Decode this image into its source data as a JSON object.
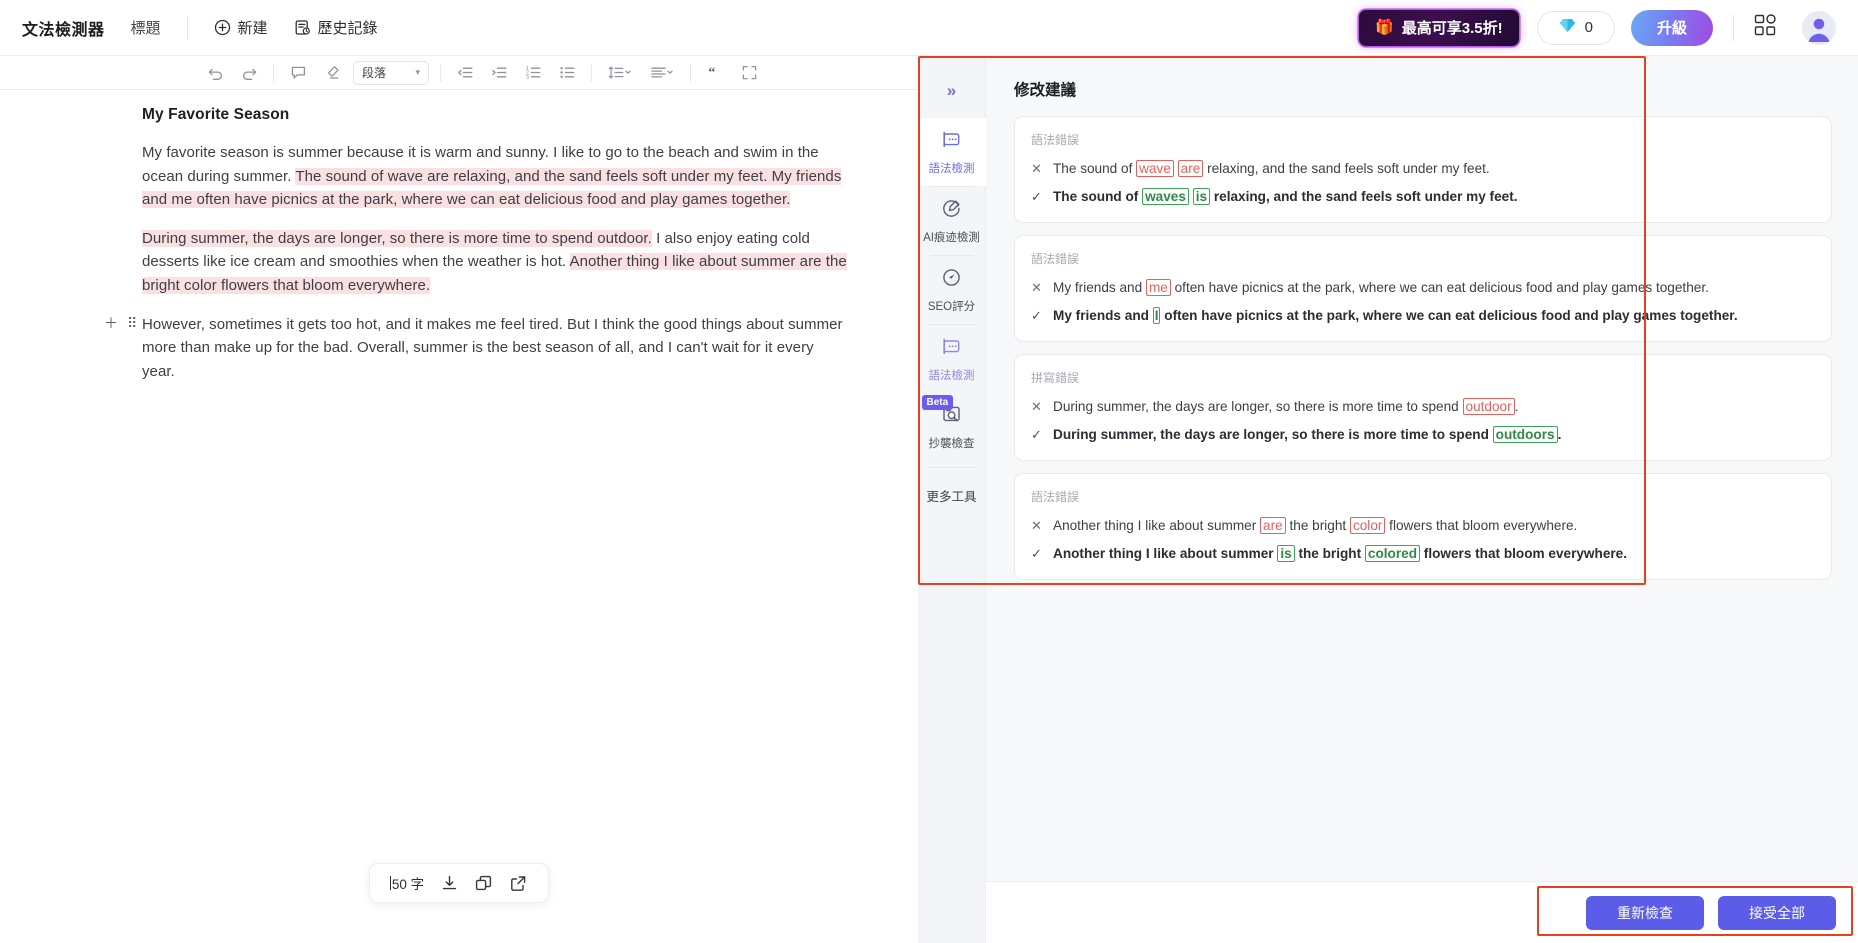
{
  "header": {
    "brand": "文法檢測器",
    "doc_title": "標題",
    "new_label": "新建",
    "history_label": "歷史記錄",
    "promo_label": "最高可享3.5折!",
    "promo_icon": "gift-icon",
    "credits_value": "0",
    "credits_icon": "diamond-icon",
    "upgrade_label": "升級",
    "grid_icon": "apps-grid-icon",
    "avatar_icon": "user-avatar-icon"
  },
  "toolbar": {
    "undo": "undo-icon",
    "redo": "redo-icon",
    "comment": "comment-icon",
    "clear_format": "eraser-icon",
    "style_select": "段落",
    "indent_decrease": "indent-decrease-icon",
    "indent_increase": "indent-increase-icon",
    "ordered_list": "ordered-list-icon",
    "bullet_list": "bullet-list-icon",
    "line_height": "line-height-icon",
    "align": "align-icon",
    "quote": "quote-icon",
    "fullscreen": "fullscreen-icon"
  },
  "document": {
    "heading": "My Favorite Season",
    "paragraph1": {
      "segments": [
        {
          "text": "My favorite season is summer because it is warm and sunny. I like to go to the beach and swim in the ocean during summer. ",
          "highlight": false
        },
        {
          "text": "The sound of wave are relaxing, and the sand feels soft under my feet. My friends and me often have picnics at the park, where we can eat delicious food and play games together.",
          "highlight": true
        }
      ]
    },
    "paragraph2": {
      "segments": [
        {
          "text": "During summer, the days are longer, so there is more time to spend outdoor.",
          "highlight": true
        },
        {
          "text": " I also enjoy eating cold desserts like ice cream and smoothies when the weather is hot. ",
          "highlight": false
        },
        {
          "text": "Another thing I like about summer are the bright color flowers that bloom everywhere.",
          "highlight": true
        }
      ]
    },
    "paragraph3": {
      "segments": [
        {
          "text": "However, sometimes it gets too hot, and it makes me feel tired. But I think the good things about summer more than make up for the bad. Overall, summer is the best season of all, and I can't wait for it every year.",
          "highlight": false
        }
      ]
    },
    "handles": {
      "add": "plus-icon",
      "drag": "drag-dots-icon"
    }
  },
  "float_bar": {
    "word_count": "50 字",
    "download_icon": "download-icon",
    "copy_icon": "copy-icon",
    "export_icon": "external-link-icon"
  },
  "rail": {
    "collapse_icon": "chevron-double-right-icon",
    "items": [
      {
        "label": "語法檢測",
        "icon": "grammar-check-icon",
        "active": true,
        "badge": ""
      },
      {
        "label": "AI痕迹檢測",
        "icon": "ai-detect-icon",
        "active": false,
        "badge": ""
      },
      {
        "label": "SEO評分",
        "icon": "seo-score-icon",
        "active": false,
        "badge": ""
      },
      {
        "label": "語法檢測",
        "icon": "grammar-check-icon",
        "active": false,
        "badge": ""
      },
      {
        "label": "抄襲檢查",
        "icon": "plagiarism-icon",
        "active": false,
        "badge": "Beta"
      }
    ],
    "more_label": "更多工具"
  },
  "suggestions": {
    "title": "修改建議",
    "cards": [
      {
        "type": "語法錯誤",
        "error_mark": "✕",
        "fix_mark": "✓",
        "error": [
          {
            "t": "The sound of ",
            "k": "plain"
          },
          {
            "t": "wave",
            "k": "bad"
          },
          {
            "t": " ",
            "k": "plain"
          },
          {
            "t": "are",
            "k": "bad"
          },
          {
            "t": " relaxing, and the sand feels soft under my feet.",
            "k": "plain"
          }
        ],
        "fix": [
          {
            "t": "The sound of ",
            "k": "plain"
          },
          {
            "t": "waves",
            "k": "good"
          },
          {
            "t": " ",
            "k": "plain"
          },
          {
            "t": "is",
            "k": "good"
          },
          {
            "t": " relaxing, and the sand feels soft under my feet.",
            "k": "plain"
          }
        ]
      },
      {
        "type": "語法錯誤",
        "error_mark": "✕",
        "fix_mark": "✓",
        "error": [
          {
            "t": "My friends and ",
            "k": "plain"
          },
          {
            "t": "me",
            "k": "bad"
          },
          {
            "t": " often have picnics at the park, where we can eat delicious food and play games together.",
            "k": "plain"
          }
        ],
        "fix": [
          {
            "t": "My friends and ",
            "k": "plain"
          },
          {
            "t": "I",
            "k": "good"
          },
          {
            "t": " often have picnics at the park, where we can eat delicious food and play games together.",
            "k": "plain"
          }
        ]
      },
      {
        "type": "拼寫錯誤",
        "error_mark": "✕",
        "fix_mark": "✓",
        "error": [
          {
            "t": "During summer, the days are longer, so there is more time to spend ",
            "k": "plain"
          },
          {
            "t": "outdoor",
            "k": "bad"
          },
          {
            "t": ".",
            "k": "plain"
          }
        ],
        "fix": [
          {
            "t": "During summer, the days are longer, so there is more time to spend ",
            "k": "plain"
          },
          {
            "t": "outdoors",
            "k": "good"
          },
          {
            "t": ".",
            "k": "plain"
          }
        ]
      },
      {
        "type": "語法錯誤",
        "error_mark": "✕",
        "fix_mark": "✓",
        "error": [
          {
            "t": "Another thing I like about summer ",
            "k": "plain"
          },
          {
            "t": "are",
            "k": "bad"
          },
          {
            "t": " the bright ",
            "k": "plain"
          },
          {
            "t": "color",
            "k": "bad"
          },
          {
            "t": " flowers that bloom everywhere.",
            "k": "plain"
          }
        ],
        "fix": [
          {
            "t": "Another thing I like about summer ",
            "k": "plain"
          },
          {
            "t": "is",
            "k": "good"
          },
          {
            "t": " the bright ",
            "k": "plain"
          },
          {
            "t": "colored",
            "k": "good"
          },
          {
            "t": " flowers that bloom everywhere.",
            "k": "plain"
          }
        ]
      }
    ]
  },
  "panel_footer": {
    "recheck_label": "重新檢查",
    "accept_all_label": "接受全部"
  },
  "colors": {
    "accent": "#5b5ce8",
    "highlight": "#fbe0e2",
    "error": "#e2615f",
    "success": "#3fa357",
    "annotation": "#e8401f"
  }
}
